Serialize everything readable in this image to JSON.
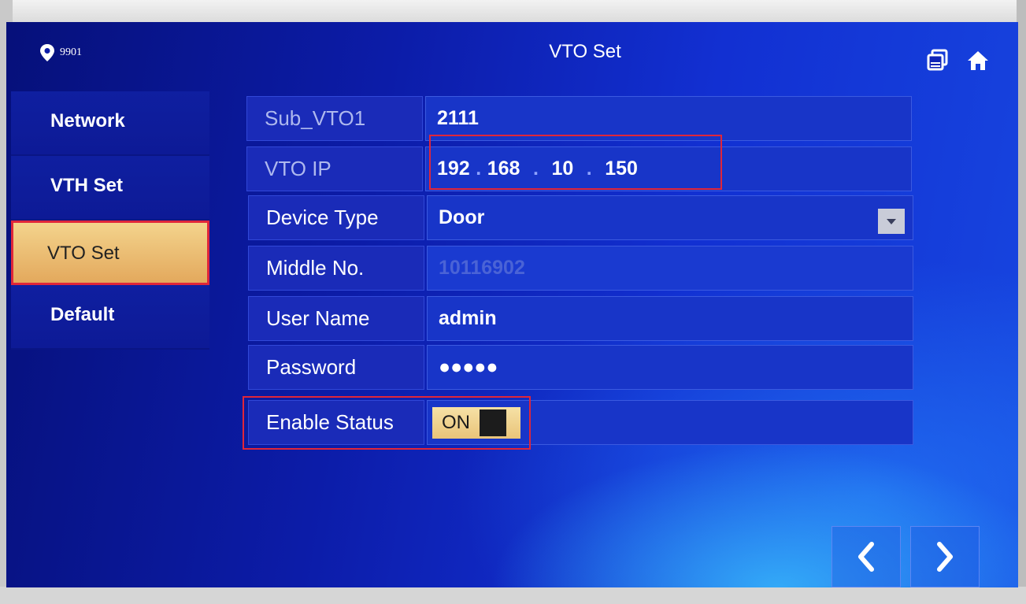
{
  "header": {
    "location": "9901",
    "title": "VTO Set"
  },
  "sidebar": {
    "items": [
      {
        "label": "Network"
      },
      {
        "label": "VTH Set"
      },
      {
        "label": "VTO Set"
      },
      {
        "label": "Default"
      }
    ],
    "selected": "VTO Set"
  },
  "form": {
    "sub_vto": {
      "label": "Sub_VTO1",
      "value": "2111"
    },
    "vto_ip": {
      "label": "VTO IP",
      "octets": [
        "192",
        "168",
        "10",
        "150"
      ]
    },
    "device_type": {
      "label": "Device Type",
      "value": "Door"
    },
    "middle_no": {
      "label": "Middle No.",
      "value": "10116902"
    },
    "user_name": {
      "label": "User Name",
      "value": "admin"
    },
    "password": {
      "label": "Password",
      "value": "●●●●●"
    },
    "enable_status": {
      "label": "Enable Status",
      "value": "ON"
    }
  },
  "colors": {
    "highlight": "#e0263a",
    "selected_bg": "#e3a85c"
  },
  "icons": {
    "location": "location-pin-icon",
    "window": "window-switch-icon",
    "home": "home-icon",
    "prev": "chevron-left-icon",
    "next": "chevron-right-icon",
    "dropdown": "caret-down-icon"
  }
}
